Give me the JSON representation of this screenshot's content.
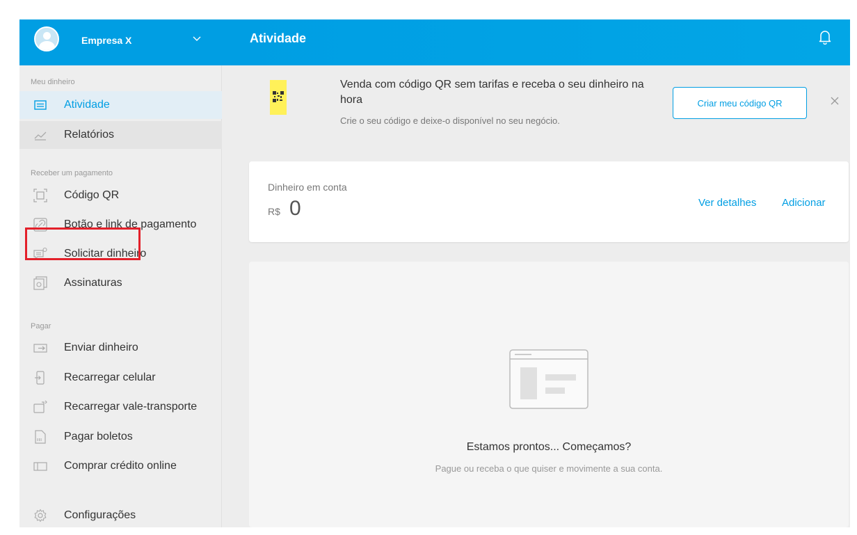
{
  "header": {
    "company": "Empresa X",
    "title": "Atividade",
    "notifications_icon": "bell-icon"
  },
  "sidebar": {
    "sections": [
      {
        "label": "Meu dinheiro",
        "items": [
          {
            "label": "Atividade",
            "icon": "activity-icon",
            "active": true
          },
          {
            "label": "Relatórios",
            "icon": "chart-icon"
          }
        ]
      },
      {
        "label": "Receber um pagamento",
        "items": [
          {
            "label": "Código QR",
            "icon": "qr-code-icon"
          },
          {
            "label": "Botão e link de pagamento",
            "icon": "link-icon"
          },
          {
            "label": "Solicitar dinheiro",
            "icon": "request-money-icon"
          },
          {
            "label": "Assinaturas",
            "icon": "subscriptions-icon"
          }
        ]
      },
      {
        "label": "Pagar",
        "items": [
          {
            "label": "Enviar dinheiro",
            "icon": "send-money-icon"
          },
          {
            "label": "Recarregar celular",
            "icon": "phone-icon"
          },
          {
            "label": "Recarregar vale-transporte",
            "icon": "transport-card-icon"
          },
          {
            "label": "Pagar boletos",
            "icon": "bill-icon"
          },
          {
            "label": "Comprar crédito online",
            "icon": "credit-icon"
          }
        ]
      }
    ],
    "settings": {
      "label": "Configurações",
      "icon": "gear-icon"
    }
  },
  "banner": {
    "title": "Venda com código QR sem tarifas e receba o seu dinheiro na hora",
    "subtitle": "Crie o seu código e deixe-o disponível no seu negócio.",
    "button": "Criar meu código QR",
    "accent": "#fff159"
  },
  "balance": {
    "label": "Dinheiro em conta",
    "currency": "R$",
    "value": "0",
    "details_link": "Ver detalhes",
    "add_link": "Adicionar"
  },
  "empty_state": {
    "title": "Estamos prontos... Começamos?",
    "subtitle": "Pague ou receba o que quiser e movimente a sua conta."
  },
  "colors": {
    "brand": "#009ee3",
    "highlight_box": "#e3202a"
  }
}
